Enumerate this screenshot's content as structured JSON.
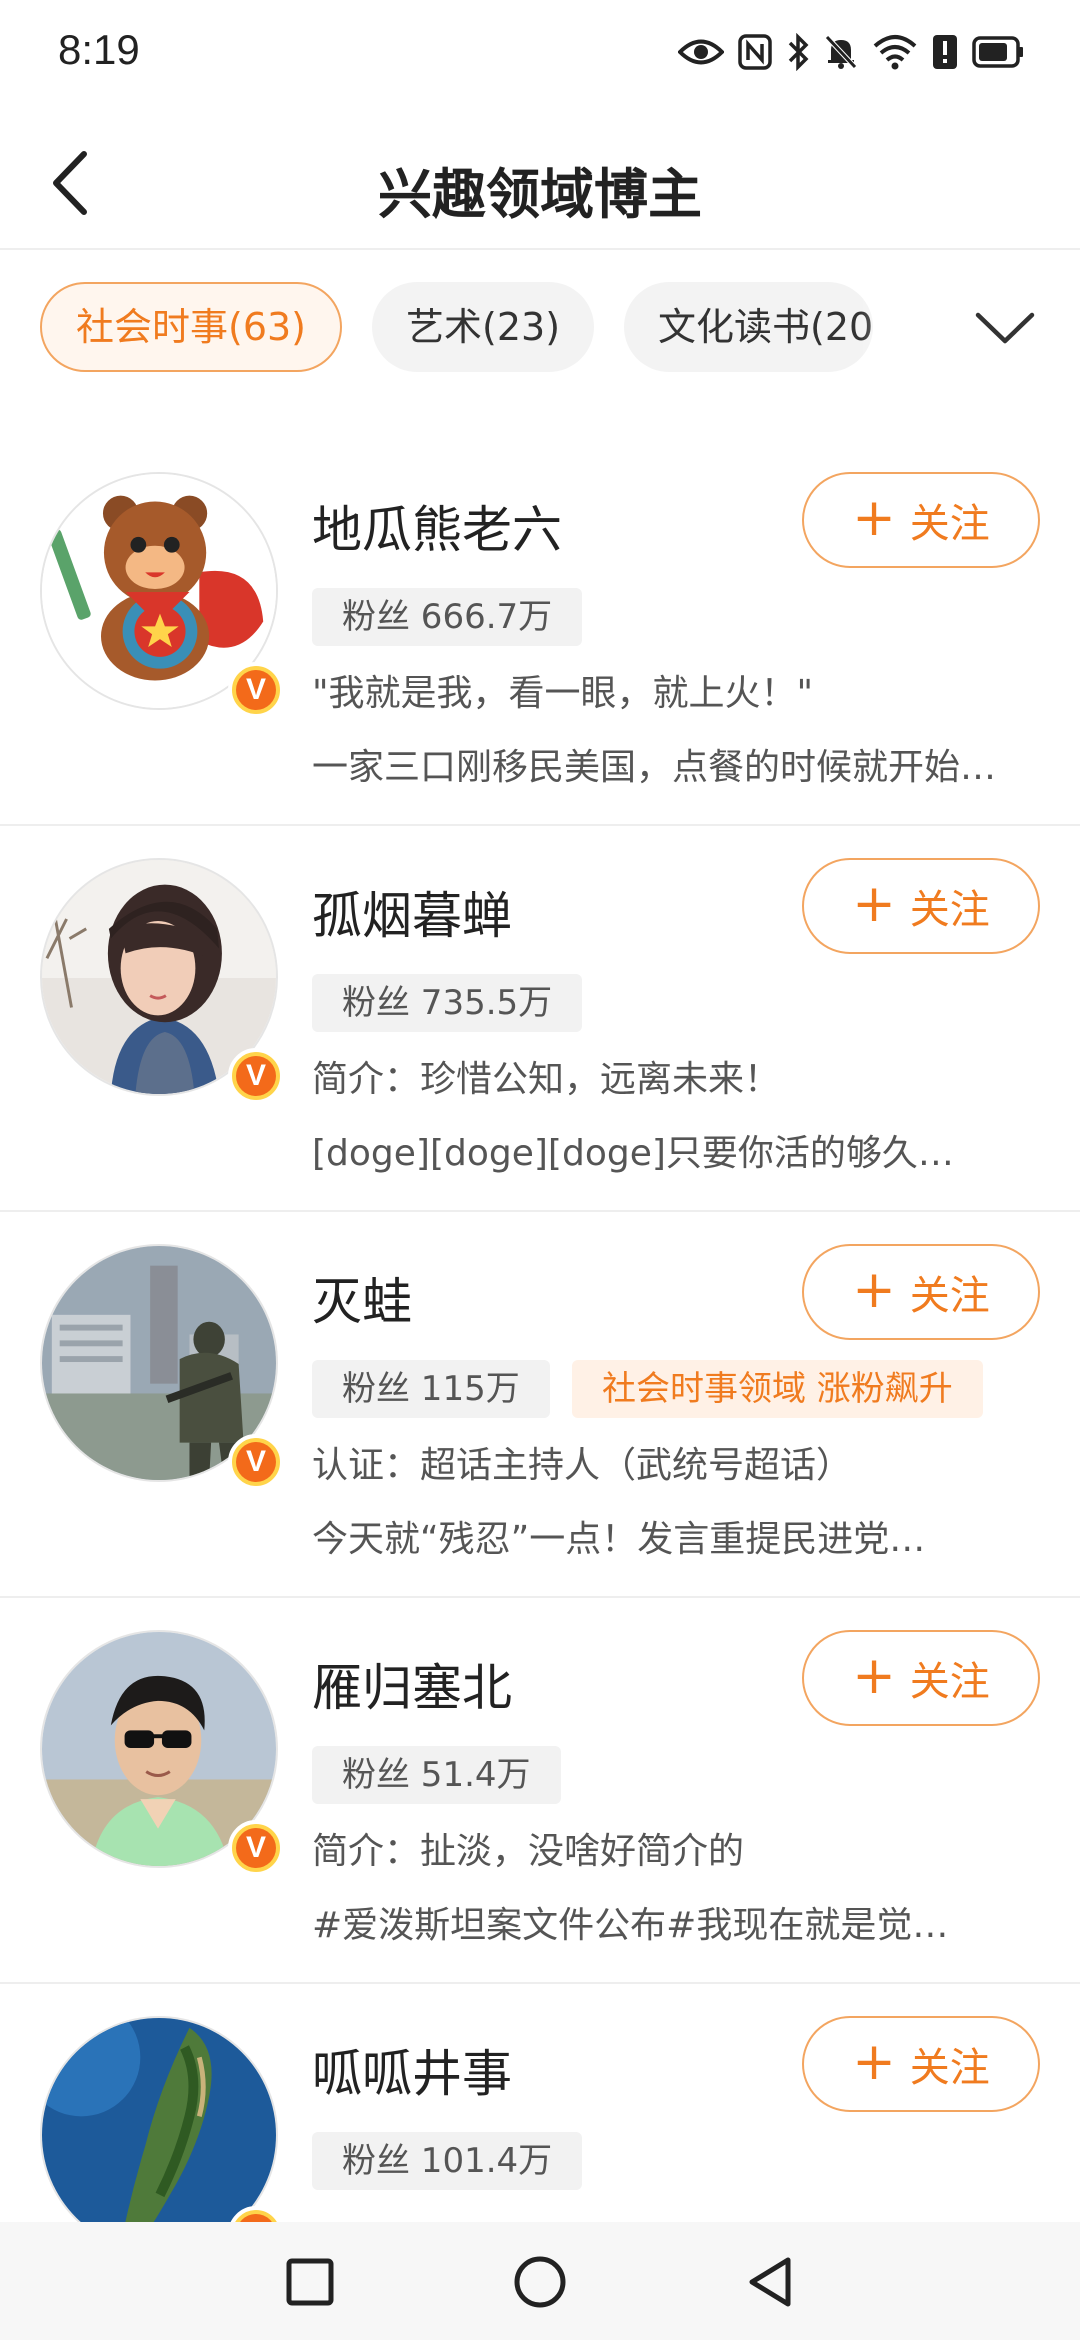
{
  "status_bar": {
    "time": "8:19",
    "icons": [
      "eye-icon",
      "nfc-icon",
      "bluetooth-icon",
      "mute-icon",
      "wifi-icon",
      "alert-icon",
      "battery-icon"
    ]
  },
  "header": {
    "title": "兴趣领域博主",
    "back_icon": "chevron-left-icon"
  },
  "tabs": [
    {
      "label": "社会时事(63)",
      "active": true
    },
    {
      "label": "艺术(23)",
      "active": false
    },
    {
      "label": "文化读书(20",
      "active": false
    }
  ],
  "expand_icon": "chevron-down-icon",
  "follow_label": "关注",
  "bloggers": [
    {
      "name": "地瓜熊老六",
      "fans": "粉丝 666.7万",
      "desc1": "\"我就是我，看一眼，就上火！\"",
      "desc2": "一家三口刚移民美国，点餐的时候就开始…",
      "avatar": "cartoon-bear-avatar",
      "verified": "V"
    },
    {
      "name": "孤烟暮蝉",
      "fans": "粉丝 735.5万",
      "desc1": "简介：珍惜公知，远离未来！",
      "desc2": "[doge][doge][doge]只要你活的够久…",
      "avatar": "woman-portrait-avatar",
      "verified": "V"
    },
    {
      "name": "灭蛙",
      "fans": "粉丝 115万",
      "tag": "社会时事领域 涨粉飙升",
      "desc1": "认证：超话主持人（武统号超话）",
      "desc2": "今天就“残忍”一点！发言重提民进党…",
      "avatar": "soldier-city-avatar",
      "verified": "V"
    },
    {
      "name": "雁归塞北",
      "fans": "粉丝 51.4万",
      "desc1": "简介：扯淡，没啥好简介的",
      "desc2": "#爱泼斯坦案文件公布#我现在就是觉…",
      "avatar": "man-sunglasses-avatar",
      "verified": "V"
    },
    {
      "name": "呱呱井事",
      "fans": "粉丝 101.4万",
      "desc1": "",
      "desc2": "",
      "avatar": "island-map-avatar",
      "verified": "V"
    }
  ],
  "sys_nav": [
    "square-icon",
    "circle-icon",
    "triangle-back-icon"
  ]
}
